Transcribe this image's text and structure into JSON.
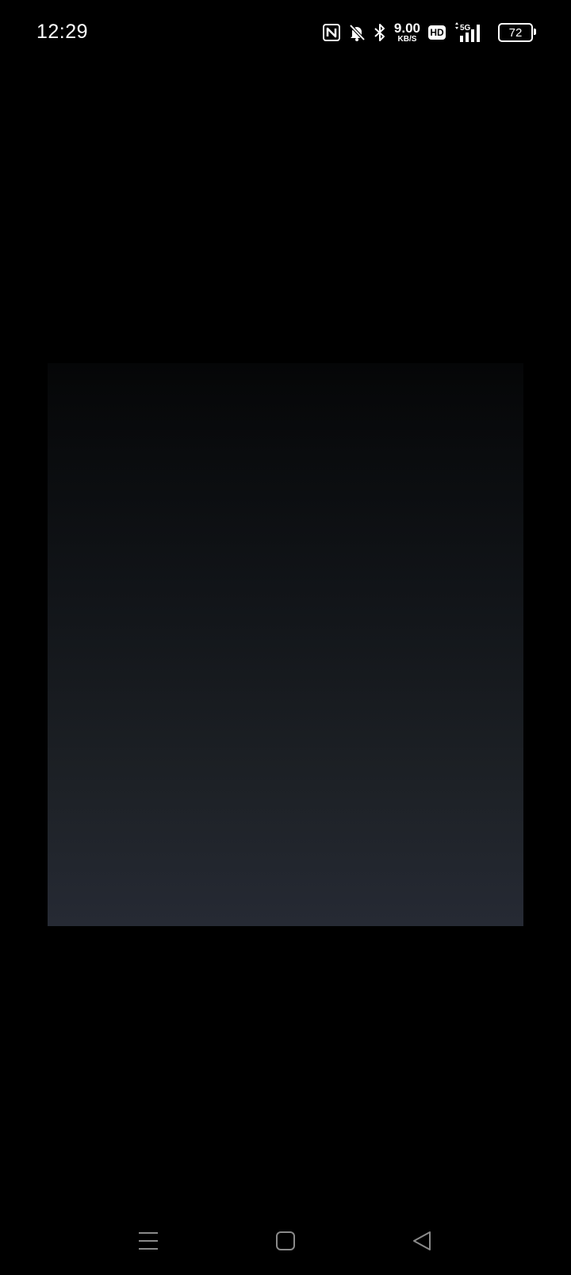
{
  "status_bar": {
    "time": "12:29",
    "net_speed_value": "9.00",
    "net_speed_unit": "KB/S",
    "hd_label": "HD",
    "network_type": "5G",
    "battery_level": "72",
    "icons": [
      "nfc-icon",
      "bell-muted-icon",
      "bluetooth-icon",
      "hd-icon",
      "signal-5g-icon",
      "battery-icon"
    ]
  },
  "content": {
    "gradient_top": "#050607",
    "gradient_bottom": "#262a34"
  },
  "nav_bar": {
    "buttons": [
      "menu",
      "home",
      "back"
    ],
    "icon_color": "#8a8a8a"
  }
}
